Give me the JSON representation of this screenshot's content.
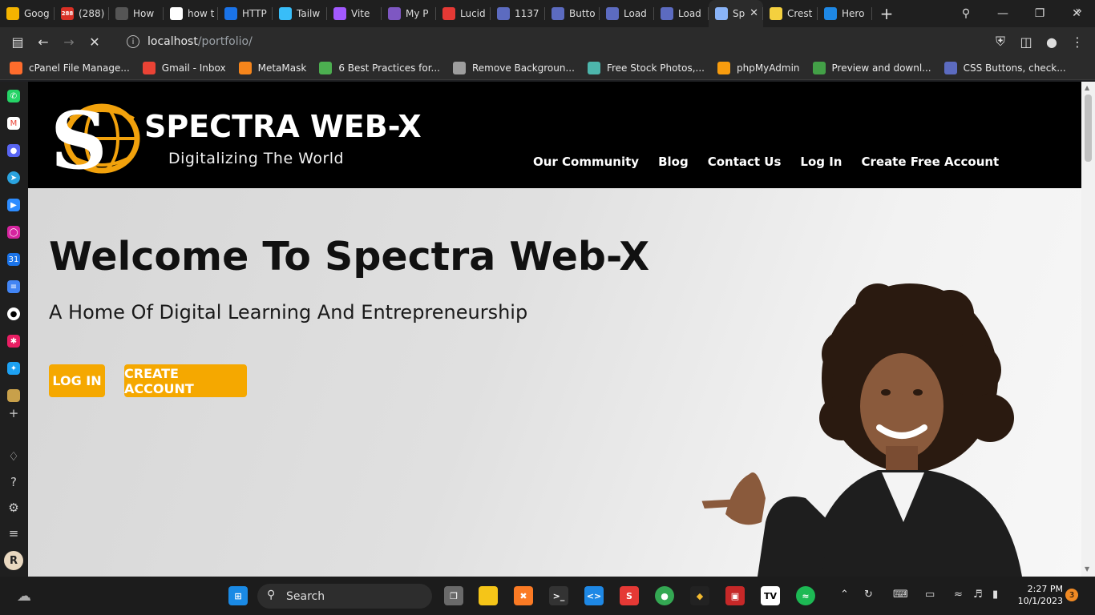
{
  "browser": {
    "tabs": [
      {
        "label": "Goog",
        "icon": "google-keep-icon",
        "color": "#f4b400"
      },
      {
        "label": "(288)",
        "icon": "badge-288-icon",
        "color": "#d93025",
        "badge": "288"
      },
      {
        "label": "How",
        "icon": "cube-icon",
        "color": "#555555"
      },
      {
        "label": "how t",
        "icon": "google-icon",
        "color": "#ffffff"
      },
      {
        "label": "HTTP",
        "icon": "infinity-icon",
        "color": "#1a73e8"
      },
      {
        "label": "Tailw",
        "icon": "tailwind-icon",
        "color": "#38bdf8"
      },
      {
        "label": "Vite",
        "icon": "vite-icon",
        "color": "#a259ff"
      },
      {
        "label": "My P",
        "icon": "hex-icon",
        "color": "#7e57c2"
      },
      {
        "label": "Lucid",
        "icon": "lucid-icon",
        "color": "#e53935"
      },
      {
        "label": "1137",
        "icon": "ui-icon",
        "color": "#5c6bc0"
      },
      {
        "label": "Butto",
        "icon": "ui-icon",
        "color": "#5c6bc0"
      },
      {
        "label": "Load",
        "icon": "ui-icon",
        "color": "#5c6bc0"
      },
      {
        "label": "Load",
        "icon": "ui-icon",
        "color": "#5c6bc0"
      },
      {
        "label": "Sp",
        "icon": "loading-icon",
        "color": "#8ab4f8",
        "active": true
      },
      {
        "label": "Crest",
        "icon": "bolt-icon",
        "color": "#f4d03f"
      },
      {
        "label": "Hero",
        "icon": "shield-icon",
        "color": "#1e88e5"
      }
    ],
    "address": {
      "host": "localhost",
      "path": "/portfolio/"
    },
    "bookmarks": [
      {
        "label": "cPanel File Manage...",
        "icon": "cpanel-icon",
        "color": "#ff6c2c"
      },
      {
        "label": "Gmail - Inbox",
        "icon": "gmail-icon",
        "color": "#ea4335"
      },
      {
        "label": "MetaMask",
        "icon": "metamask-icon",
        "color": "#f6851b"
      },
      {
        "label": "6 Best Practices for...",
        "icon": "leaf-icon",
        "color": "#4caf50"
      },
      {
        "label": "Remove Backgroun...",
        "icon": "layers-icon",
        "color": "#9e9e9e"
      },
      {
        "label": "Free Stock Photos,...",
        "icon": "d-icon",
        "color": "#4db6ac"
      },
      {
        "label": "phpMyAdmin",
        "icon": "phpmyadmin-icon",
        "color": "#f89c0e"
      },
      {
        "label": "Preview and downl...",
        "icon": "rp-icon",
        "color": "#43a047"
      },
      {
        "label": "CSS Buttons, check...",
        "icon": "ui-icon",
        "color": "#5c6bc0"
      }
    ]
  },
  "site": {
    "brand": "SPECTRA WEB-X",
    "tagline": "Digitalizing The World",
    "nav": [
      "Our Community",
      "Blog",
      "Contact Us",
      "Log In",
      "Create Free Account"
    ],
    "hero_title": "Welcome To Spectra Web-X",
    "hero_subtitle": "A Home Of Digital Learning And Entrepreneurship",
    "login_button": "LOG IN",
    "create_button": "CREATE ACCOUNT",
    "accent": "#f5a800"
  },
  "taskbar": {
    "search_label": "Search",
    "time": "2:27 PM",
    "date": "10/1/2023",
    "notification_count": "3"
  }
}
